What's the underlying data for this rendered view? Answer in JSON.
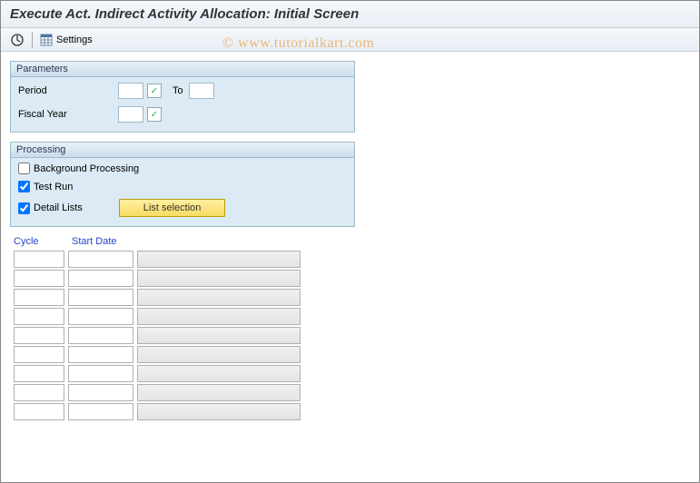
{
  "title": "Execute Act. Indirect Activity Allocation: Initial Screen",
  "toolbar": {
    "execute_icon": "execute",
    "settings_label": "Settings"
  },
  "watermark": "© www.tutorialkart.com",
  "parameters": {
    "title": "Parameters",
    "period_label": "Period",
    "to_label": "To",
    "fiscal_year_label": "Fiscal Year"
  },
  "processing": {
    "title": "Processing",
    "background_label": "Background Processing",
    "background_checked": false,
    "testrun_label": "Test Run",
    "testrun_checked": true,
    "detail_label": "Detail Lists",
    "detail_checked": true,
    "list_selection_label": "List selection"
  },
  "table": {
    "cycle_header": "Cycle",
    "start_date_header": "Start Date",
    "row_count": 9
  }
}
